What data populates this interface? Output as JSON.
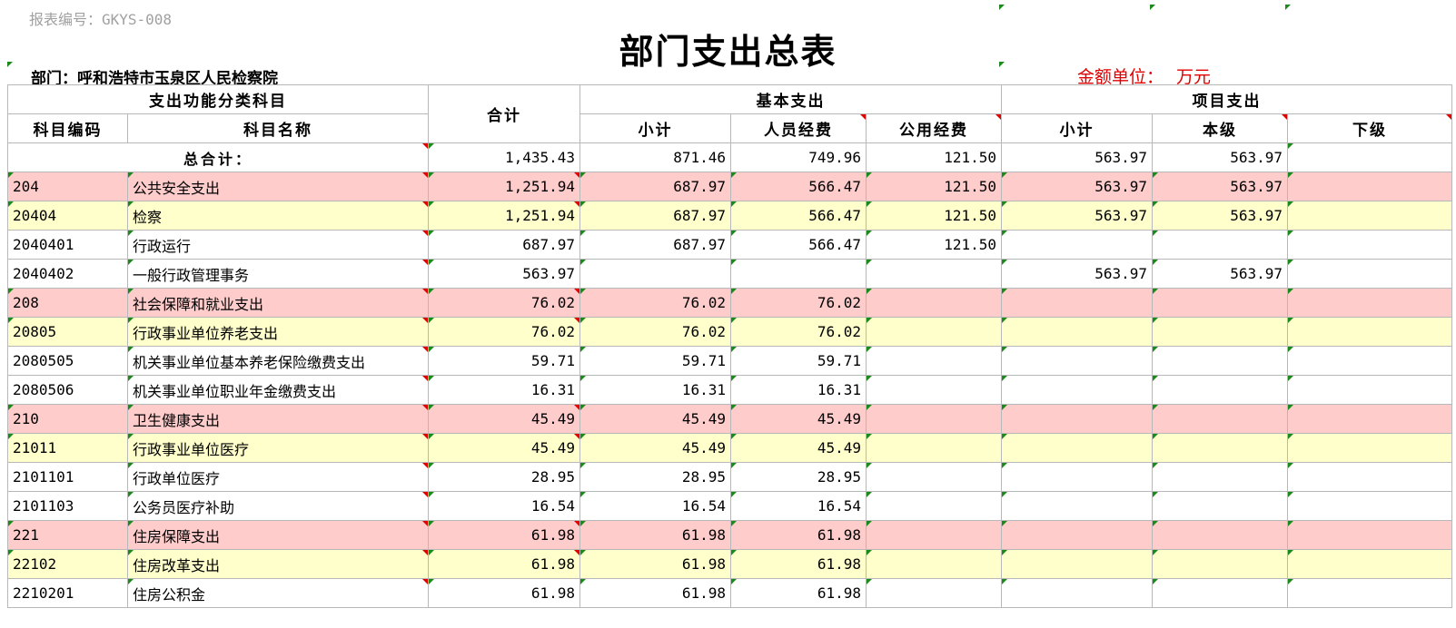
{
  "report_code": "报表编号：GKYS-008",
  "title": "部门支出总表",
  "department": "部门：呼和浩特市玉泉区人民检察院",
  "unit": {
    "label": "金额单位：",
    "value": "万元"
  },
  "headers": {
    "function_class": "支出功能分类科目",
    "code": "科目编码",
    "name": "科目名称",
    "total": "合计",
    "basic": "基本支出",
    "basic_subtotal": "小计",
    "personnel": "人员经费",
    "public": "公用经费",
    "project": "项目支出",
    "project_subtotal": "小计",
    "same_level": "本级",
    "lower_level": "下级"
  },
  "total_row": {
    "label": "总合计：",
    "total": "1,435.43",
    "basic_subtotal": "871.46",
    "personnel": "749.96",
    "public": "121.50",
    "project_subtotal": "563.97",
    "same_level": "563.97",
    "lower_level": ""
  },
  "rows": [
    {
      "level": 1,
      "code": "204",
      "name": "公共安全支出",
      "total": "1,251.94",
      "basic_subtotal": "687.97",
      "personnel": "566.47",
      "public": "121.50",
      "project_subtotal": "563.97",
      "same_level": "563.97",
      "lower_level": ""
    },
    {
      "level": 2,
      "code": "20404",
      "name": "检察",
      "total": "1,251.94",
      "basic_subtotal": "687.97",
      "personnel": "566.47",
      "public": "121.50",
      "project_subtotal": "563.97",
      "same_level": "563.97",
      "lower_level": ""
    },
    {
      "level": 3,
      "code": "2040401",
      "name": "行政运行",
      "total": "687.97",
      "basic_subtotal": "687.97",
      "personnel": "566.47",
      "public": "121.50",
      "project_subtotal": "",
      "same_level": "",
      "lower_level": ""
    },
    {
      "level": 3,
      "code": "2040402",
      "name": "一般行政管理事务",
      "total": "563.97",
      "basic_subtotal": "",
      "personnel": "",
      "public": "",
      "project_subtotal": "563.97",
      "same_level": "563.97",
      "lower_level": ""
    },
    {
      "level": 1,
      "code": "208",
      "name": "社会保障和就业支出",
      "total": "76.02",
      "basic_subtotal": "76.02",
      "personnel": "76.02",
      "public": "",
      "project_subtotal": "",
      "same_level": "",
      "lower_level": ""
    },
    {
      "level": 2,
      "code": "20805",
      "name": "行政事业单位养老支出",
      "total": "76.02",
      "basic_subtotal": "76.02",
      "personnel": "76.02",
      "public": "",
      "project_subtotal": "",
      "same_level": "",
      "lower_level": ""
    },
    {
      "level": 3,
      "code": "2080505",
      "name": "机关事业单位基本养老保险缴费支出",
      "total": "59.71",
      "basic_subtotal": "59.71",
      "personnel": "59.71",
      "public": "",
      "project_subtotal": "",
      "same_level": "",
      "lower_level": ""
    },
    {
      "level": 3,
      "code": "2080506",
      "name": "机关事业单位职业年金缴费支出",
      "total": "16.31",
      "basic_subtotal": "16.31",
      "personnel": "16.31",
      "public": "",
      "project_subtotal": "",
      "same_level": "",
      "lower_level": ""
    },
    {
      "level": 1,
      "code": "210",
      "name": "卫生健康支出",
      "total": "45.49",
      "basic_subtotal": "45.49",
      "personnel": "45.49",
      "public": "",
      "project_subtotal": "",
      "same_level": "",
      "lower_level": ""
    },
    {
      "level": 2,
      "code": "21011",
      "name": "行政事业单位医疗",
      "total": "45.49",
      "basic_subtotal": "45.49",
      "personnel": "45.49",
      "public": "",
      "project_subtotal": "",
      "same_level": "",
      "lower_level": ""
    },
    {
      "level": 3,
      "code": "2101101",
      "name": "行政单位医疗",
      "total": "28.95",
      "basic_subtotal": "28.95",
      "personnel": "28.95",
      "public": "",
      "project_subtotal": "",
      "same_level": "",
      "lower_level": ""
    },
    {
      "level": 3,
      "code": "2101103",
      "name": "公务员医疗补助",
      "total": "16.54",
      "basic_subtotal": "16.54",
      "personnel": "16.54",
      "public": "",
      "project_subtotal": "",
      "same_level": "",
      "lower_level": ""
    },
    {
      "level": 1,
      "code": "221",
      "name": "住房保障支出",
      "total": "61.98",
      "basic_subtotal": "61.98",
      "personnel": "61.98",
      "public": "",
      "project_subtotal": "",
      "same_level": "",
      "lower_level": ""
    },
    {
      "level": 2,
      "code": "22102",
      "name": "住房改革支出",
      "total": "61.98",
      "basic_subtotal": "61.98",
      "personnel": "61.98",
      "public": "",
      "project_subtotal": "",
      "same_level": "",
      "lower_level": ""
    },
    {
      "level": 3,
      "code": "2210201",
      "name": "住房公积金",
      "total": "61.98",
      "basic_subtotal": "61.98",
      "personnel": "61.98",
      "public": "",
      "project_subtotal": "",
      "same_level": "",
      "lower_level": ""
    }
  ],
  "colors": {
    "level1_bg": "#ffcccc",
    "level2_bg": "#ffffcc",
    "unit_text": "#e00000",
    "report_code_text": "#a0a0a0",
    "green_marker": "#1a8a1a",
    "red_marker": "#e00000"
  }
}
